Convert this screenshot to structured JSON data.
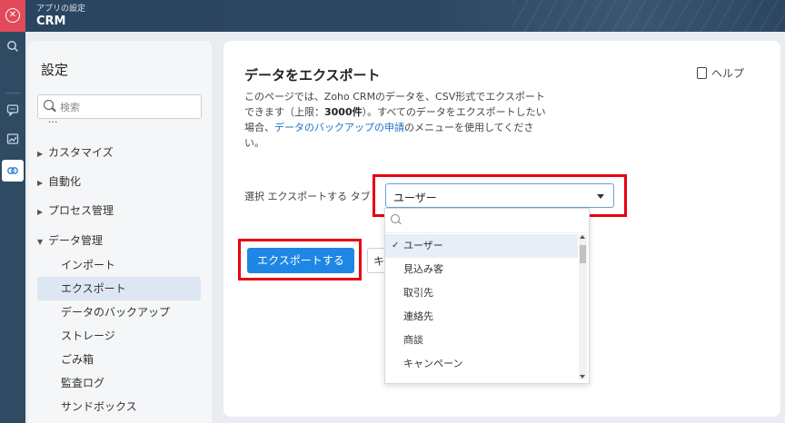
{
  "header": {
    "subtitle": "アプリの設定",
    "title": "CRM"
  },
  "rail": {
    "close_icon": "✕",
    "items": [
      "search-icon",
      "chat-icon",
      "analytics-icon",
      "integration-icon"
    ]
  },
  "settings": {
    "heading": "設定",
    "search_placeholder": "検索",
    "cut_item": "...",
    "nav": [
      {
        "label": "カスタマイズ"
      },
      {
        "label": "自動化"
      },
      {
        "label": "プロセス管理"
      },
      {
        "label": "データ管理"
      }
    ],
    "data_management_items": [
      "インポート",
      "エクスポート",
      "データのバックアップ",
      "ストレージ",
      "ごみ箱",
      "監査ログ",
      "サンドボックス"
    ]
  },
  "main": {
    "title": "データをエクスポート",
    "help": "ヘルプ",
    "desc": {
      "line1": "このページでは、Zoho CRMのデータを、CSV形式でエクスポート",
      "line2_a": "できます（上限：",
      "line2_b": "3000件",
      "line2_c": "）。すべてのデータをエクスポートしたい",
      "line3_a": "場合、",
      "line3_link": "データのバックアップの申請",
      "line3_b": "のメニューを使用してくださ",
      "line4": "い。"
    },
    "select_label": "選択 エクスポートする タブ",
    "select_value": "ユーザー",
    "dropdown_options": [
      "ユーザー",
      "見込み客",
      "取引先",
      "連絡先",
      "商談",
      "キャンペーン"
    ],
    "selected_option": "ユーザー",
    "export_button": "エクスポートする",
    "cancel_button": "キャンセル"
  },
  "colors": {
    "header_bg": "#2c4660",
    "accent": "#1e87e5",
    "highlight_frame": "#e60012",
    "close_red": "#e04a5a"
  }
}
